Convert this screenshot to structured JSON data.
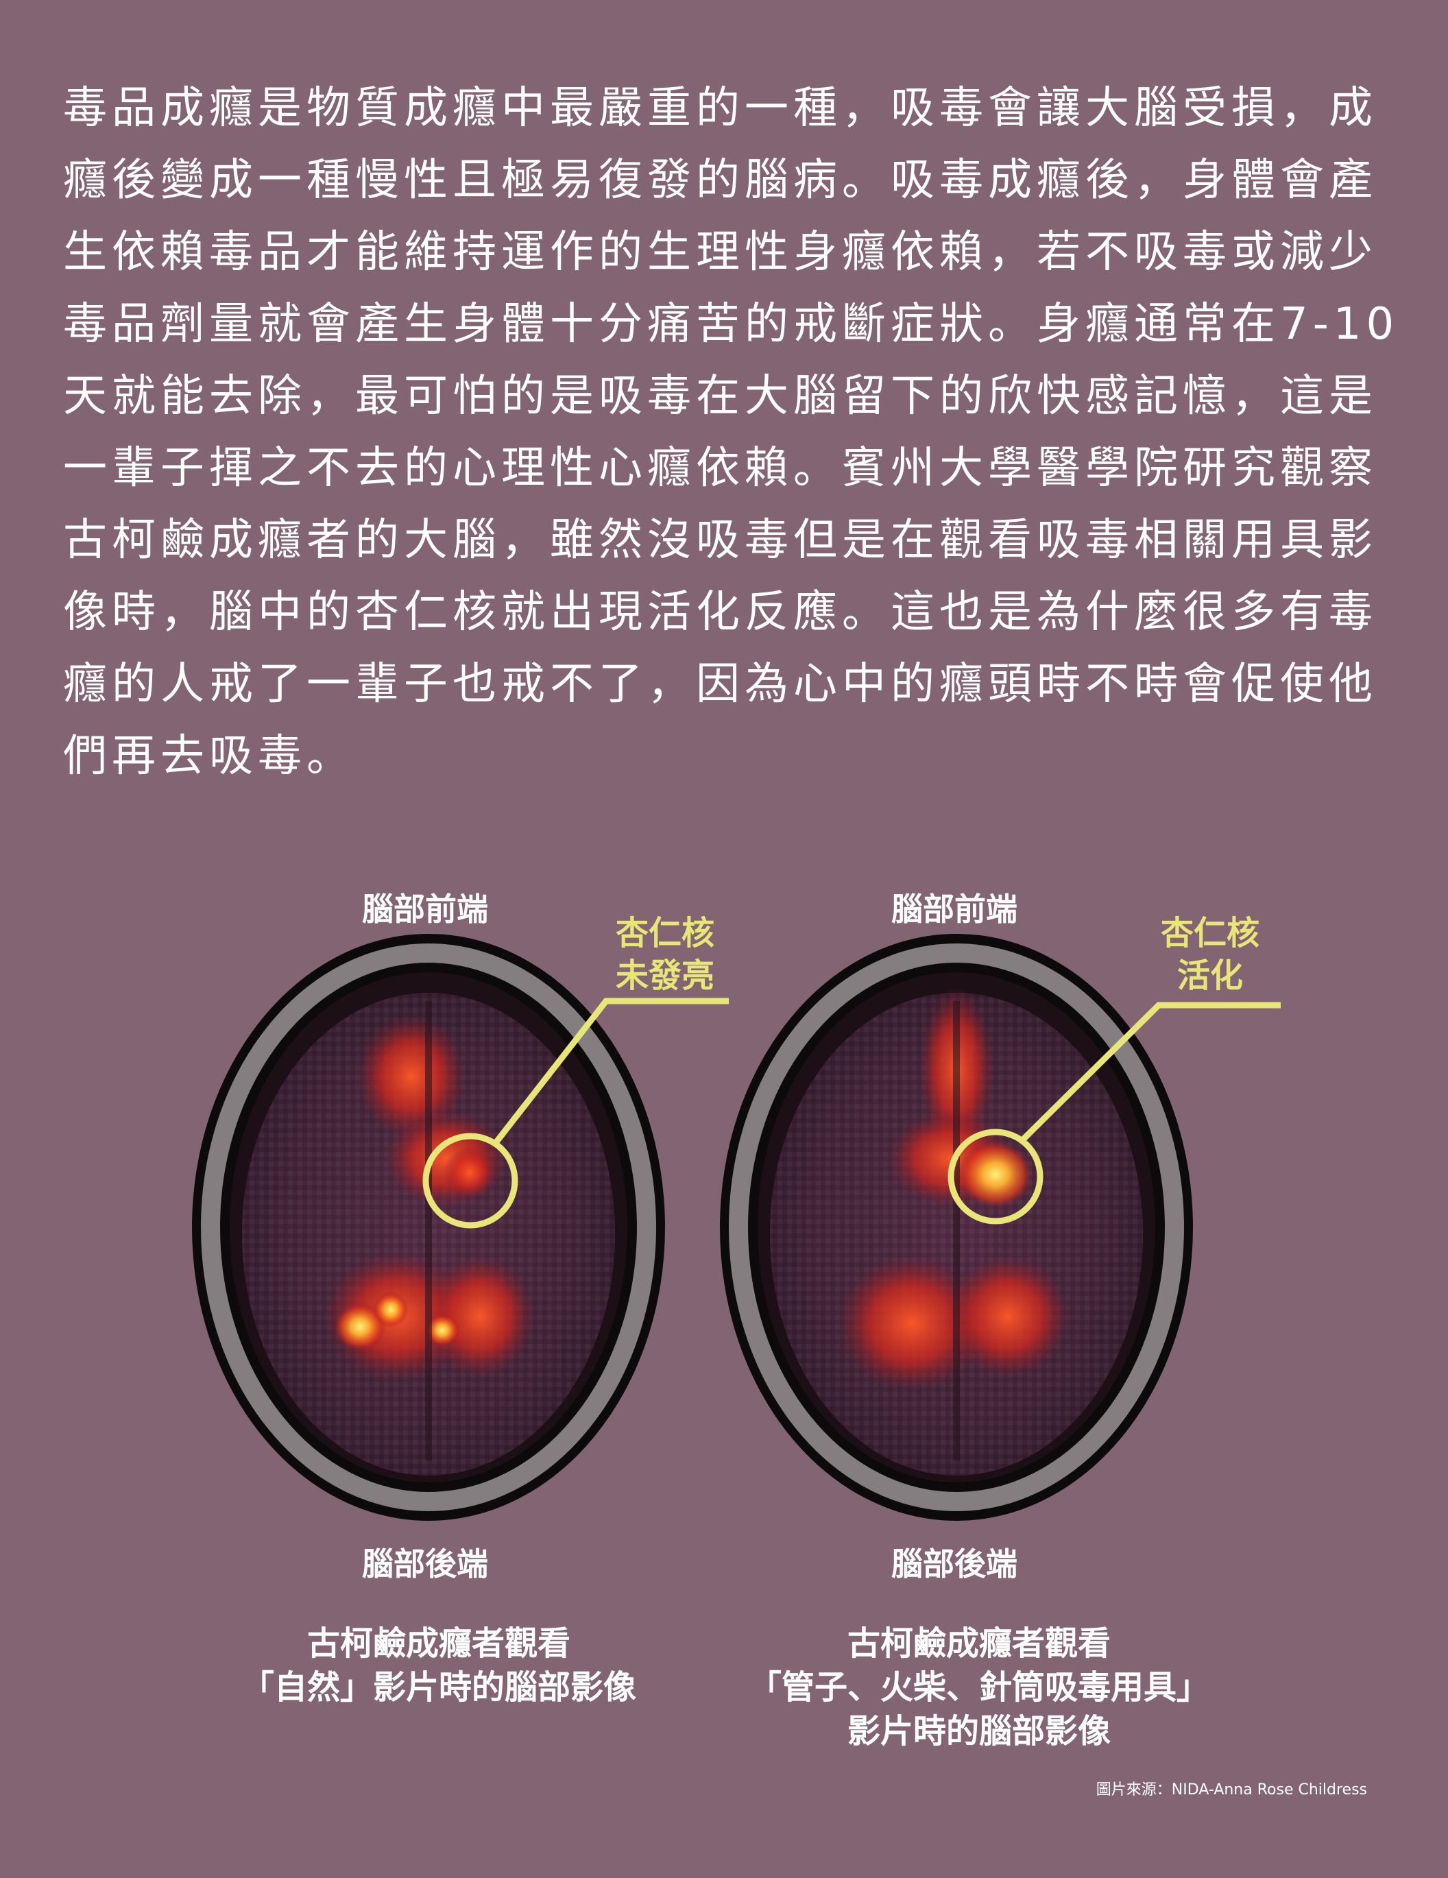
{
  "intro": {
    "lines": [
      "毒品成癮是物質成癮中最嚴重的一種，吸毒會讓大腦受損，成",
      "癮後變成一種慢性且極易復發的腦病。吸毒成癮後，身體會產",
      "生依賴毒品才能維持運作的生理性身癮依賴，若不吸毒或減少",
      "毒品劑量就會產生身體十分痛苦的戒斷症狀。身癮通常在7-10",
      "天就能去除，最可怕的是吸毒在大腦留下的欣快感記憶，這是",
      "一輩子揮之不去的心理性心癮依賴。賓州大學醫學院研究觀察",
      "古柯鹼成癮者的大腦，雖然沒吸毒但是在觀看吸毒相關用具影",
      "像時，腦中的杏仁核就出現活化反應。這也是為什麼很多有毒",
      "癮的人戒了一輩子也戒不了，因為心中的癮頭時不時會促使他",
      "們再去吸毒。"
    ]
  },
  "scans": [
    {
      "front_label": "腦部前端",
      "back_label": "腦部後端",
      "callout": [
        "杏仁核",
        "未發亮"
      ],
      "caption": [
        "古柯鹼成癮者觀看",
        "「自然」影片時的腦部影像"
      ]
    },
    {
      "front_label": "腦部前端",
      "back_label": "腦部後端",
      "callout": [
        "杏仁核",
        "活化"
      ],
      "caption": [
        "古柯鹼成癮者觀看",
        "「管子、火柴、針筒吸毒用具」",
        "影片時的腦部影像"
      ]
    }
  ],
  "credit": "圖片來源：NIDA-Anna Rose Childress",
  "colors": {
    "background": "#836473",
    "callout": "#e9e679",
    "text": "#ffffff"
  }
}
